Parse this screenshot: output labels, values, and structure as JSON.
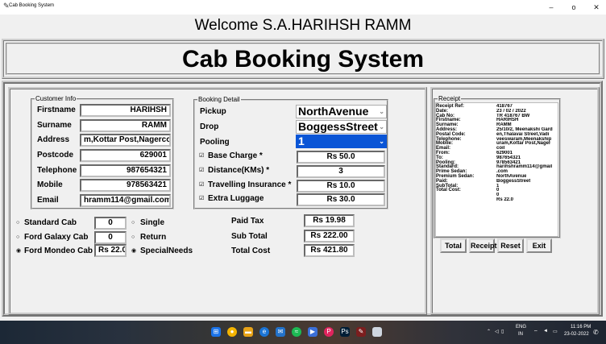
{
  "window": {
    "title": "Cab Booking System",
    "controls": [
      "–",
      "ο",
      "✕"
    ]
  },
  "welcome": "Welcome S.A.HARIHSH RAMM",
  "main_title": "Cab Booking System",
  "customer": {
    "legend": "Customer Info",
    "fields": [
      {
        "label": "Firstname",
        "value": "HARIHSH"
      },
      {
        "label": "Surname",
        "value": "RAMM"
      },
      {
        "label": "Address",
        "value": "m,Kottar Post,Nagercoil"
      },
      {
        "label": "Postcode",
        "value": "629001"
      },
      {
        "label": "Telephone",
        "value": "987654321"
      },
      {
        "label": "Mobile",
        "value": "978563421"
      },
      {
        "label": "Email",
        "value": "hramm114@gmail.com"
      }
    ]
  },
  "booking": {
    "legend": "Booking Detail",
    "pickup": {
      "label": "Pickup",
      "value": "NorthAvenue"
    },
    "drop": {
      "label": "Drop",
      "value": "BoggessStreet"
    },
    "pooling": {
      "label": "Pooling",
      "value": "1"
    },
    "charges": [
      {
        "label": "Base Charge *",
        "value": "Rs 50.0",
        "checked": true
      },
      {
        "label": "Distance(KMs) *",
        "value": "3",
        "checked": true
      },
      {
        "label": "Travelling Insurance *",
        "value": "Rs 10.0",
        "checked": true
      },
      {
        "label": "Extra Luggage",
        "value": "Rs 30.0",
        "checked": true
      }
    ]
  },
  "cabs": [
    {
      "label": "Standard Cab",
      "value": "0",
      "selected": false
    },
    {
      "label": "Ford Galaxy Cab",
      "value": "0",
      "selected": false
    },
    {
      "label": "Ford Mondeo Cab",
      "value": "Rs 22.0",
      "selected": true
    }
  ],
  "trip": [
    {
      "label": "Single",
      "selected": false
    },
    {
      "label": "Return",
      "selected": false
    },
    {
      "label": "SpecialNeeds",
      "selected": true
    }
  ],
  "totals": [
    {
      "label": "Paid Tax",
      "value": "Rs 19.98"
    },
    {
      "label": "Sub Total",
      "value": "Rs 222.00"
    },
    {
      "label": "Total Cost",
      "value": "Rs 421.80"
    }
  ],
  "receipt": {
    "legend": "Receipt",
    "labels": [
      "Receipt Ref:",
      "Date:",
      "Cab No:",
      "Firstname:",
      "Surname:",
      "Address:",
      "Postal Code:",
      "Telephone:",
      "Mobile:",
      "Email:",
      "From:",
      "To:",
      "Pooling:",
      "Standard:",
      "Prime Sedan:",
      "Premium Sedan:",
      "Paid:",
      "SubTotal:",
      "Total Cost:"
    ],
    "values": [
      "418767",
      " 23 / 02 / 2022",
      "TR 418767 BW",
      "HARIHSH",
      "RAMM",
      "25/10/2, Meenakshi Gard",
      "en,Thalavai Street,Vadi",
      "veeswaram,Meenakship",
      "uram,Kottar Post,Nager",
      "coil",
      "629001",
      "987654321",
      "978563421",
      "harihshramm114@gmail",
      ".com",
      "NorthAvenue",
      "BoggessStreet",
      "1",
      "0",
      "0",
      "Rs 22.0"
    ]
  },
  "buttons": {
    "total": "Total",
    "receipt": "Receipt",
    "reset": "Reset",
    "exit": "Exit"
  },
  "taskbar": {
    "lang_top": "ENG",
    "lang_bottom": "IN",
    "time": "11:16 PM",
    "date": "23-02-2022"
  },
  "colors": {
    "selection": "#0a55d6",
    "window_bg": "#f0f0f0"
  }
}
